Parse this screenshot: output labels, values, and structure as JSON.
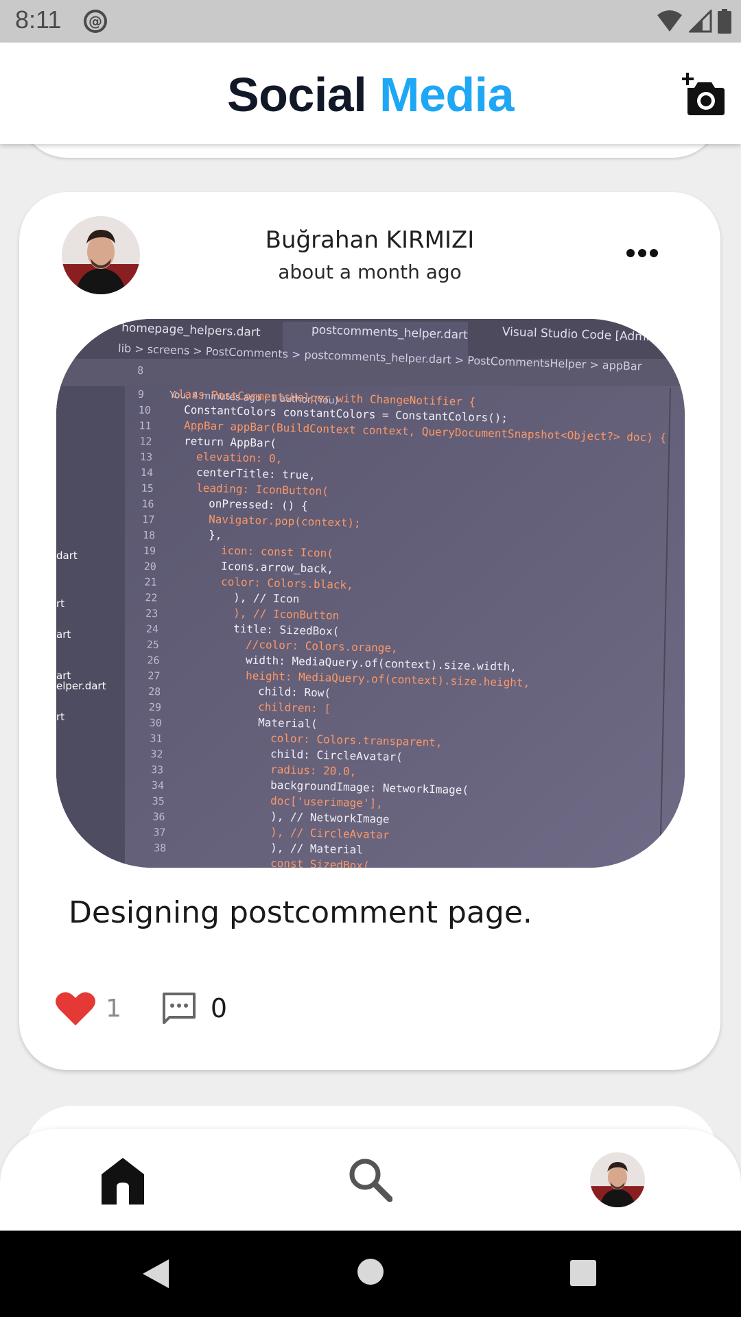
{
  "status_bar": {
    "time": "8:11"
  },
  "app_bar": {
    "title_part1": "Social",
    "title_part2": "Media",
    "brand_color": "#1ea7f5"
  },
  "post": {
    "author": "Buğrahan KIRMIZI",
    "time_ago": "about a month ago",
    "caption": "Designing postcomment page.",
    "likes": "1",
    "comments": "0"
  },
  "code_image": {
    "tabs": [
      "homepage_helpers.dart",
      "postcomments_helper.dart",
      "Visual Studio Code [Admin"
    ],
    "breadcrumb": "lib > screens > PostComments > postcomments_helper.dart > PostCommentsHelper > appBar",
    "blame": "You, 4 minutes ago | 1 author (You)",
    "line_numbers": [
      "8",
      "9",
      "10",
      "11",
      "12",
      "13",
      "14",
      "15",
      "16",
      "17",
      "18",
      "19",
      "20",
      "21",
      "22",
      "23",
      "24",
      "25",
      "26",
      "27",
      "28",
      "29",
      "30",
      "31",
      "32",
      "33",
      "34",
      "35",
      "36",
      "37",
      "38"
    ],
    "lines": [
      "",
      "class PostCommentsHelper with ChangeNotifier {",
      "ConstantColors constantColors = ConstantColors();",
      "AppBar appBar(BuildContext context, QueryDocumentSnapshot<Object?> doc) {",
      "return AppBar(",
      "elevation: 0,",
      "centerTitle: true,",
      "leading: IconButton(",
      "onPressed: () {",
      "Navigator.pop(context);",
      "},",
      "icon: const Icon(",
      "Icons.arrow_back,",
      "color: Colors.black,",
      "), // Icon",
      "), // IconButton",
      "title: SizedBox(",
      "//color: Colors.orange,",
      "width: MediaQuery.of(context).size.width,",
      "height: MediaQuery.of(context).size.height,",
      "child: Row(",
      "children: [",
      "Material(",
      "color: Colors.transparent,",
      "child: CircleAvatar(",
      "radius: 20.0,",
      "backgroundImage: NetworkImage(",
      "doc['userimage'],",
      "), // NetworkImage",
      "), // CircleAvatar",
      "), // Material",
      "const SizedBox("
    ],
    "sidebar": [
      "dart",
      "rt",
      "art",
      "art",
      "elper.dart",
      "rt"
    ]
  }
}
